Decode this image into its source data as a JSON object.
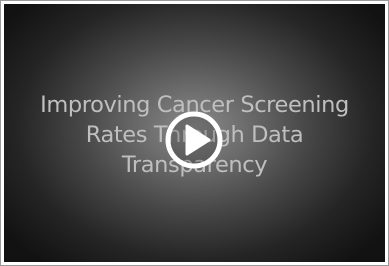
{
  "video": {
    "title_lines": [
      "Improving Cancer Screening",
      "Rates Through Data",
      "Transparency"
    ],
    "play_icon": "play-icon",
    "colors": {
      "text": "#bfbfbf",
      "background_center": "#8a8a8a",
      "background_edge": "#121212",
      "play_ring": "#ffffff"
    }
  }
}
